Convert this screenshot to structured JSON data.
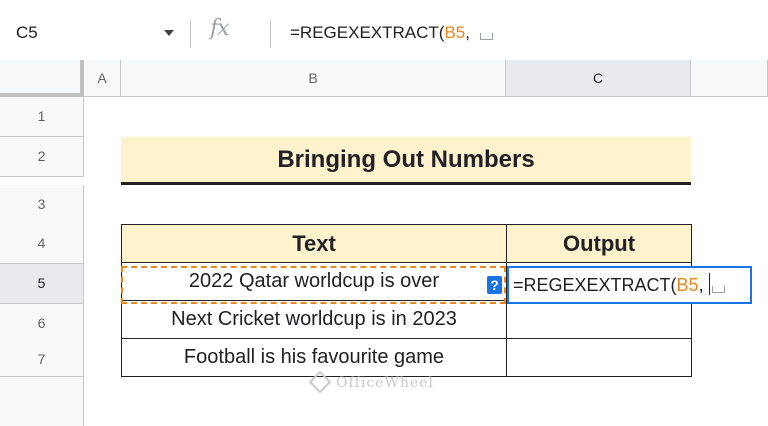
{
  "formula_bar": {
    "name_box": "C5",
    "fx_label": "fx",
    "formula_prefix": "=REGEXEXTRACT(",
    "formula_ref": "B5",
    "formula_suffix": ","
  },
  "columns": [
    "A",
    "B",
    "C"
  ],
  "rows": [
    "1",
    "2",
    "3",
    "4",
    "5",
    "6",
    "7"
  ],
  "sheet": {
    "title": "Bringing Out Numbers",
    "table_headers": {
      "text": "Text",
      "output": "Output"
    },
    "table_rows": [
      {
        "text": "2022 Qatar worldcup is over",
        "output": ""
      },
      {
        "text": "Next Cricket worldcup is in 2023",
        "output": ""
      },
      {
        "text": "Football is his favourite game",
        "output": ""
      }
    ]
  },
  "editor": {
    "help_label": "?",
    "formula_prefix": "=REGEXEXTRACT(",
    "formula_ref": "B5",
    "formula_suffix": ","
  },
  "watermark": "OfficeWheel",
  "colors": {
    "accent_blue": "#1a73e8",
    "ref_orange": "#e8871e",
    "header_fill": "#fff2cc"
  }
}
